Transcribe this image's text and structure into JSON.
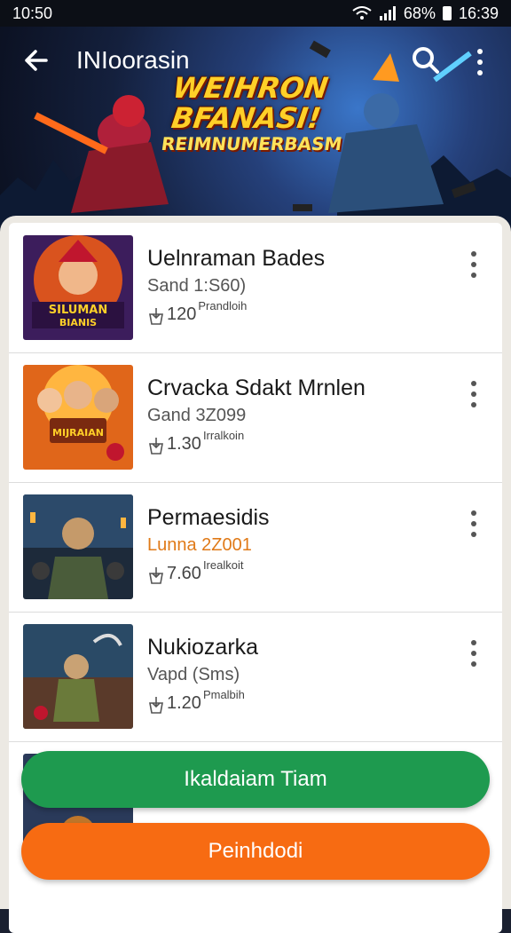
{
  "status_bar": {
    "time": "10:50",
    "battery": "68%",
    "clock": "16:39"
  },
  "header": {
    "title": "INIoorasin",
    "banner_line1": "WEIHRON",
    "banner_line2": "BFANASI!",
    "banner_line3": "REIMNUMERBASM"
  },
  "items": [
    {
      "title": "Uelnraman Bades",
      "sub": "Sand 1:S60)",
      "downloads": "120",
      "note": "Prandloih"
    },
    {
      "title": "Crvacka Sdakt Mrnlen",
      "sub": "Gand 3Z099",
      "downloads": "1.30",
      "note": "Irralkoin"
    },
    {
      "title": "Permaesidis",
      "sub": "Lunna 2Z001",
      "downloads": "7.60",
      "note": "Irealkoit"
    },
    {
      "title": "Nukiozarka",
      "sub": "Vapd (Sms)",
      "downloads": "1.20",
      "note": "Pmalbih"
    }
  ],
  "thumb_texts": {
    "t1": "SILUMAN\nBIANIS",
    "t2": "MIJRAIAN"
  },
  "buttons": {
    "primary": "Ikaldaiam Tiam",
    "secondary": "Peinhdodi"
  },
  "colors": {
    "green": "#1e9a4f",
    "orange": "#f76b12",
    "accent_sub": "#e07a18"
  }
}
